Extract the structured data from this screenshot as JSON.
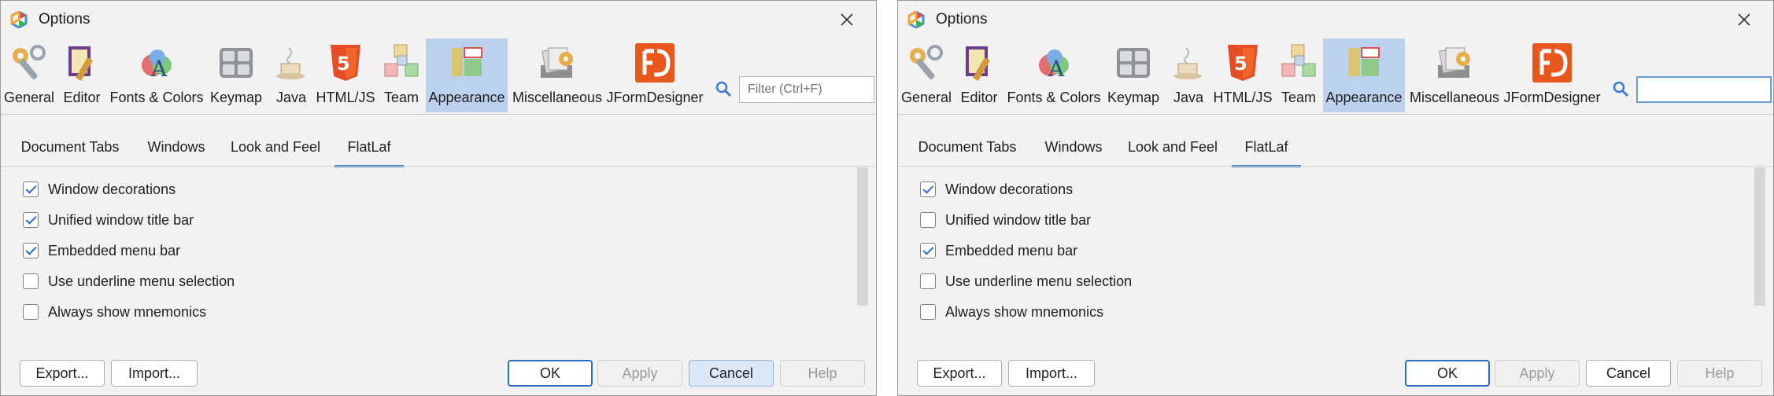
{
  "windows": [
    {
      "title": "Options",
      "categories": [
        "General",
        "Editor",
        "Fonts & Colors",
        "Keymap",
        "Java",
        "HTML/JS",
        "Team",
        "Appearance",
        "Miscellaneous",
        "JFormDesigner"
      ],
      "selected_category": "Appearance",
      "filter": {
        "placeholder": "Filter (Ctrl+F)",
        "value": ""
      },
      "tabs": [
        "Document Tabs",
        "Windows",
        "Look and Feel",
        "FlatLaf"
      ],
      "selected_tab": "FlatLaf",
      "options": [
        {
          "label": "Window decorations",
          "checked": true
        },
        {
          "label": "Unified window title bar",
          "checked": true
        },
        {
          "label": "Embedded menu bar",
          "checked": true
        },
        {
          "label": "Use underline menu selection",
          "checked": false
        },
        {
          "label": "Always show mnemonics",
          "checked": false
        }
      ],
      "buttons": {
        "export": "Export...",
        "import": "Import...",
        "ok": "OK",
        "apply": "Apply",
        "cancel": "Cancel",
        "help": "Help"
      }
    },
    {
      "title": "Options",
      "categories": [
        "General",
        "Editor",
        "Fonts & Colors",
        "Keymap",
        "Java",
        "HTML/JS",
        "Team",
        "Appearance",
        "Miscellaneous",
        "JFormDesigner"
      ],
      "selected_category": "Appearance",
      "filter": {
        "placeholder": "",
        "value": ""
      },
      "tabs": [
        "Document Tabs",
        "Windows",
        "Look and Feel",
        "FlatLaf"
      ],
      "selected_tab": "FlatLaf",
      "options": [
        {
          "label": "Window decorations",
          "checked": true
        },
        {
          "label": "Unified window title bar",
          "checked": false
        },
        {
          "label": "Embedded menu bar",
          "checked": true
        },
        {
          "label": "Use underline menu selection",
          "checked": false
        },
        {
          "label": "Always show mnemonics",
          "checked": false
        }
      ],
      "buttons": {
        "export": "Export...",
        "import": "Import...",
        "ok": "OK",
        "apply": "Apply",
        "cancel": "Cancel",
        "help": "Help"
      }
    }
  ],
  "colors": {
    "accent": "#3f7dc6",
    "selection": "#bcd1ed",
    "window_bg": "#f2f2f2"
  },
  "icons": [
    "app-icon",
    "close-icon",
    "general-icon",
    "editor-icon",
    "fonts-colors-icon",
    "keymap-icon",
    "java-icon",
    "html-js-icon",
    "team-icon",
    "appearance-icon",
    "miscellaneous-icon",
    "jformdesigner-icon",
    "search-icon",
    "checkbox-check-icon"
  ]
}
